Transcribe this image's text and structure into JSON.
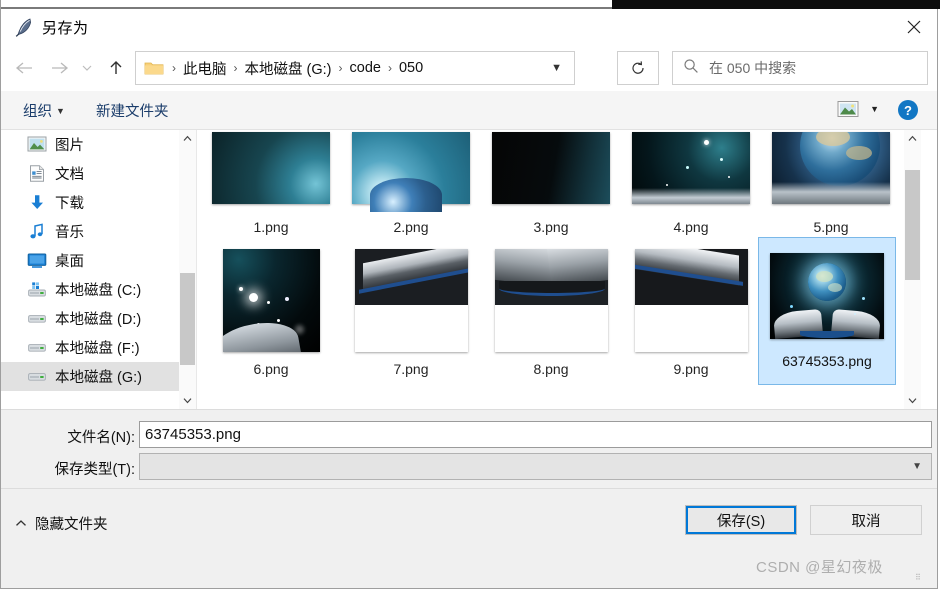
{
  "window": {
    "title": "另存为",
    "title_icon": "quill-feather-icon",
    "close_label": "✕"
  },
  "nav": {
    "back_icon": "arrow-left-icon",
    "forward_icon": "arrow-right-icon",
    "history_icon": "chevron-down-icon",
    "up_icon": "arrow-up-icon",
    "refresh_icon": "refresh-icon",
    "folder_icon": "folder-icon",
    "dropdown_icon": "chevron-down-icon",
    "breadcrumbs": [
      "此电脑",
      "本地磁盘 (G:)",
      "code",
      "050"
    ],
    "separator": "›"
  },
  "search": {
    "icon": "search-icon",
    "placeholder": "在 050 中搜索"
  },
  "commandbar": {
    "organize_label": "组织",
    "organize_caret": "▼",
    "new_folder_label": "新建文件夹",
    "view_icon": "picture-view-icon",
    "view_caret": "▼",
    "help_icon": "help-question-icon",
    "help_label": "?"
  },
  "sidebar": {
    "items": [
      {
        "label": "图片",
        "icon": "pictures-icon",
        "selected": false
      },
      {
        "label": "文档",
        "icon": "documents-icon",
        "selected": false
      },
      {
        "label": "下载",
        "icon": "downloads-icon",
        "selected": false
      },
      {
        "label": "音乐",
        "icon": "music-icon",
        "selected": false
      },
      {
        "label": "桌面",
        "icon": "desktop-icon",
        "selected": false
      },
      {
        "label": "本地磁盘 (C:)",
        "icon": "system-drive-icon",
        "selected": false
      },
      {
        "label": "本地磁盘 (D:)",
        "icon": "drive-icon",
        "selected": false
      },
      {
        "label": "本地磁盘 (F:)",
        "icon": "drive-icon",
        "selected": false
      },
      {
        "label": "本地磁盘 (G:)",
        "icon": "drive-icon",
        "selected": true
      }
    ],
    "scroll_up_icon": "chevron-up-icon",
    "scroll_down_icon": "chevron-down-icon"
  },
  "filelist": {
    "scroll_up_icon": "chevron-up-icon",
    "scroll_down_icon": "chevron-down-icon",
    "files": [
      {
        "name": "1.png",
        "selected": false
      },
      {
        "name": "2.png",
        "selected": false
      },
      {
        "name": "3.png",
        "selected": false
      },
      {
        "name": "4.png",
        "selected": false
      },
      {
        "name": "5.png",
        "selected": false
      },
      {
        "name": "6.png",
        "selected": false
      },
      {
        "name": "7.png",
        "selected": false
      },
      {
        "name": "8.png",
        "selected": false
      },
      {
        "name": "9.png",
        "selected": false
      },
      {
        "name": "63745353.png",
        "selected": true
      }
    ]
  },
  "form": {
    "filename_label": "文件名(N):",
    "filename_value": "63745353.png",
    "filetype_label": "保存类型(T):",
    "filetype_value": "",
    "filetype_caret": "▼"
  },
  "footer": {
    "hide_folders_label": "隐藏文件夹",
    "hide_folders_caret": "︿",
    "save_label": "保存(S)",
    "cancel_label": "取消"
  },
  "watermark": {
    "text": "CSDN @星幻夜极"
  },
  "colors": {
    "accent": "#0078d7",
    "selection_bg": "#cde8ff",
    "selection_border": "#7ab8e8",
    "sidebar_selected": "#e1e1e1",
    "command_text": "#1b3d6b"
  }
}
